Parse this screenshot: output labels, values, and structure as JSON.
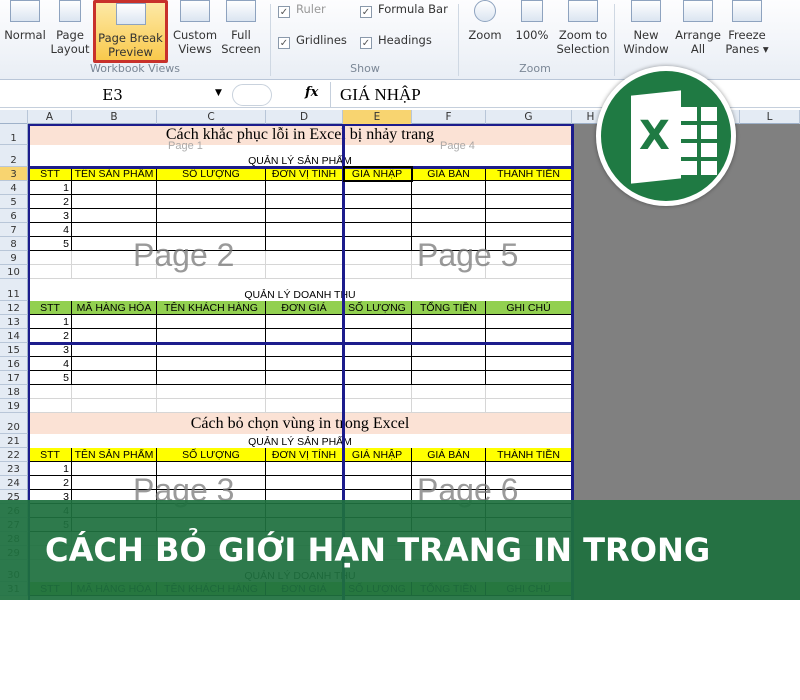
{
  "ribbon": {
    "workbook_views": {
      "label": "Workbook Views",
      "buttons": [
        {
          "label1": "Normal",
          "label2": ""
        },
        {
          "label1": "Page",
          "label2": "Layout"
        },
        {
          "label1": "Page Break",
          "label2": "Preview"
        },
        {
          "label1": "Custom",
          "label2": "Views"
        },
        {
          "label1": "Full",
          "label2": "Screen"
        }
      ]
    },
    "show": {
      "label": "Show",
      "checks": [
        {
          "label": "Ruler",
          "checked": true
        },
        {
          "label": "Formula Bar",
          "checked": true
        },
        {
          "label": "Gridlines",
          "checked": true
        },
        {
          "label": "Headings",
          "checked": true
        }
      ]
    },
    "zoom": {
      "label": "Zoom",
      "buttons": [
        {
          "label1": "Zoom",
          "label2": ""
        },
        {
          "label1": "100%",
          "label2": ""
        },
        {
          "label1": "Zoom to",
          "label2": "Selection"
        }
      ]
    },
    "window": {
      "buttons": [
        {
          "label1": "New",
          "label2": "Window"
        },
        {
          "label1": "Arrange",
          "label2": "All"
        },
        {
          "label1": "Freeze",
          "label2": "Panes ▾"
        }
      ]
    }
  },
  "formula_bar": {
    "name_box": "E3",
    "fx": "fx",
    "value": "GIÁ NHẬP"
  },
  "columns": [
    "A",
    "B",
    "C",
    "D",
    "E",
    "F",
    "G",
    "H",
    "I",
    "J",
    "K",
    "L"
  ],
  "selected_cell": "E3",
  "rows": [
    {
      "n": "1",
      "type": "title",
      "text": "Cách khắc phục lỗi in Excel bị nhảy trang"
    },
    {
      "n": "2",
      "type": "sub",
      "text": "QUẢN LÝ SẢN PHẨM"
    },
    {
      "n": "3",
      "type": "yellow",
      "cells": [
        "STT",
        "TÊN SẢN PHẨM",
        "SỐ LƯỢNG",
        "ĐƠN VỊ TÍNH",
        "GIÁ NHẬP",
        "GIÁ BÁN",
        "THÀNH TIỀN"
      ]
    },
    {
      "n": "4",
      "type": "data",
      "cells": [
        "1",
        "",
        "",
        "",
        "",
        "",
        ""
      ]
    },
    {
      "n": "5",
      "type": "data",
      "cells": [
        "2",
        "",
        "",
        "",
        "",
        "",
        ""
      ]
    },
    {
      "n": "6",
      "type": "data",
      "cells": [
        "3",
        "",
        "",
        "",
        "",
        "",
        ""
      ]
    },
    {
      "n": "7",
      "type": "data",
      "cells": [
        "4",
        "",
        "",
        "",
        "",
        "",
        ""
      ]
    },
    {
      "n": "8",
      "type": "data",
      "cells": [
        "5",
        "",
        "",
        "",
        "",
        "",
        ""
      ]
    },
    {
      "n": "9",
      "type": "blank"
    },
    {
      "n": "10",
      "type": "blank"
    },
    {
      "n": "11",
      "type": "sub",
      "text": "QUẢN LÝ DOANH THU"
    },
    {
      "n": "12",
      "type": "green",
      "cells": [
        "STT",
        "MÃ HÀNG HÓA",
        "TÊN KHÁCH HÀNG",
        "ĐƠN GIÁ",
        "SỐ LƯỢNG",
        "TỔNG TIỀN",
        "GHI CHÚ"
      ]
    },
    {
      "n": "13",
      "type": "data",
      "cells": [
        "1",
        "",
        "",
        "",
        "",
        "",
        ""
      ]
    },
    {
      "n": "14",
      "type": "data",
      "cells": [
        "2",
        "",
        "",
        "",
        "",
        "",
        ""
      ]
    },
    {
      "n": "15",
      "type": "data",
      "cells": [
        "3",
        "",
        "",
        "",
        "",
        "",
        ""
      ]
    },
    {
      "n": "16",
      "type": "data",
      "cells": [
        "4",
        "",
        "",
        "",
        "",
        "",
        ""
      ]
    },
    {
      "n": "17",
      "type": "data",
      "cells": [
        "5",
        "",
        "",
        "",
        "",
        "",
        ""
      ]
    },
    {
      "n": "18",
      "type": "blank"
    },
    {
      "n": "19",
      "type": "blank"
    },
    {
      "n": "20",
      "type": "title",
      "text": "Cách bỏ chọn vùng in trong Excel"
    },
    {
      "n": "21",
      "type": "subshort",
      "text": "QUẢN LÝ SẢN PHẨM"
    },
    {
      "n": "22",
      "type": "yellow",
      "cells": [
        "STT",
        "TÊN SẢN PHẨM",
        "SỐ LƯỢNG",
        "ĐƠN VỊ TÍNH",
        "GIÁ NHẬP",
        "GIÁ BÁN",
        "THÀNH TIỀN"
      ]
    },
    {
      "n": "23",
      "type": "data",
      "cells": [
        "1",
        "",
        "",
        "",
        "",
        "",
        ""
      ]
    },
    {
      "n": "24",
      "type": "data",
      "cells": [
        "2",
        "",
        "",
        "",
        "",
        "",
        ""
      ]
    },
    {
      "n": "25",
      "type": "data",
      "cells": [
        "3",
        "",
        "",
        "",
        "",
        "",
        ""
      ]
    },
    {
      "n": "26",
      "type": "data",
      "cells": [
        "4",
        "",
        "",
        "",
        "",
        "",
        ""
      ]
    },
    {
      "n": "27",
      "type": "data",
      "cells": [
        "5",
        "",
        "",
        "",
        "",
        "",
        ""
      ]
    },
    {
      "n": "28",
      "type": "blank"
    },
    {
      "n": "29",
      "type": "blank"
    },
    {
      "n": "30",
      "type": "sub",
      "text": "QUẢN LÝ DOANH THU"
    },
    {
      "n": "31",
      "type": "green",
      "cells": [
        "STT",
        "MÃ HÀNG HÓA",
        "TÊN KHÁCH HÀNG",
        "ĐƠN GIÁ",
        "SỐ LƯỢNG",
        "TỔNG TIỀN",
        "GHI CHÚ"
      ]
    }
  ],
  "page_labels": [
    "Page 1",
    "Page 2",
    "Page 3",
    "Page 4",
    "Page 5",
    "Page 6"
  ],
  "banner": {
    "text": "CÁCH BỎ GIỚI HẠN TRANG IN TRONG EXCEL"
  },
  "colors": {
    "yellow_header": "#ffff00",
    "green_header": "#92d050",
    "title_fill": "#fbe2d5",
    "page_break": "#1c1c8c",
    "banner": "#1e703e",
    "excel_green": "#1f7a43"
  },
  "logo": {
    "icon": "excel-logo",
    "letter": "X"
  }
}
